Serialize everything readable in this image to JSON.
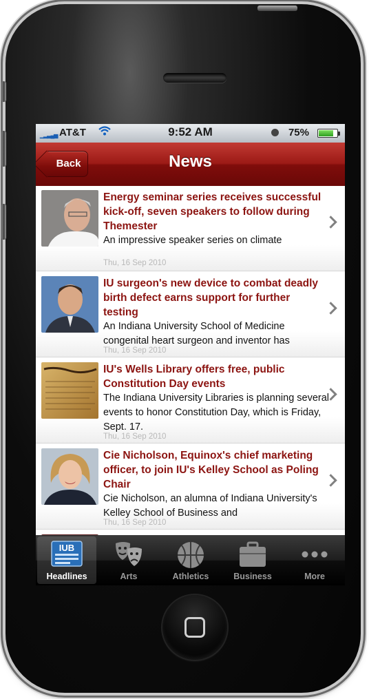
{
  "status": {
    "carrier": "AT&T",
    "time": "9:52 AM",
    "battery": "75%"
  },
  "nav": {
    "back_label": "Back",
    "title": "News"
  },
  "articles": [
    {
      "headline": "Energy seminar series receives successful kick-off, seven speakers to follow during Themester",
      "summary": "An impressive speaker series on climate",
      "date": "Thu, 16 Sep 2010"
    },
    {
      "headline": "IU surgeon's new device to combat deadly birth defect earns support for further testing",
      "summary": "An Indiana University School of Medicine congenital heart surgeon and inventor has",
      "date": "Thu, 16 Sep 2010"
    },
    {
      "headline": "IU's Wells Library offers free, public Constitution Day events",
      "summary": "The Indiana University Libraries is planning several events to honor Constitution Day, which is Friday, Sept. 17.",
      "date": "Thu, 16 Sep 2010"
    },
    {
      "headline": "Cie Nicholson, Equinox's chief marketing officer, to join IU's Kelley School as Poling Chair",
      "summary": "Cie Nicholson, an alumna of Indiana University's Kelley School of Business and",
      "date": "Thu, 16 Sep 2010"
    }
  ],
  "tabs": [
    {
      "label": "Headlines",
      "icon": "iub-newspaper-icon",
      "active": true,
      "icon_text": "IUB"
    },
    {
      "label": "Arts",
      "icon": "theater-masks-icon",
      "active": false
    },
    {
      "label": "Athletics",
      "icon": "basketball-icon",
      "active": false
    },
    {
      "label": "Business",
      "icon": "briefcase-icon",
      "active": false
    },
    {
      "label": "More",
      "icon": "more-dots-icon",
      "active": false
    }
  ],
  "colors": {
    "nav_red": "#9c1a16",
    "headline_red": "#8c1411",
    "tab_black": "#000000"
  }
}
